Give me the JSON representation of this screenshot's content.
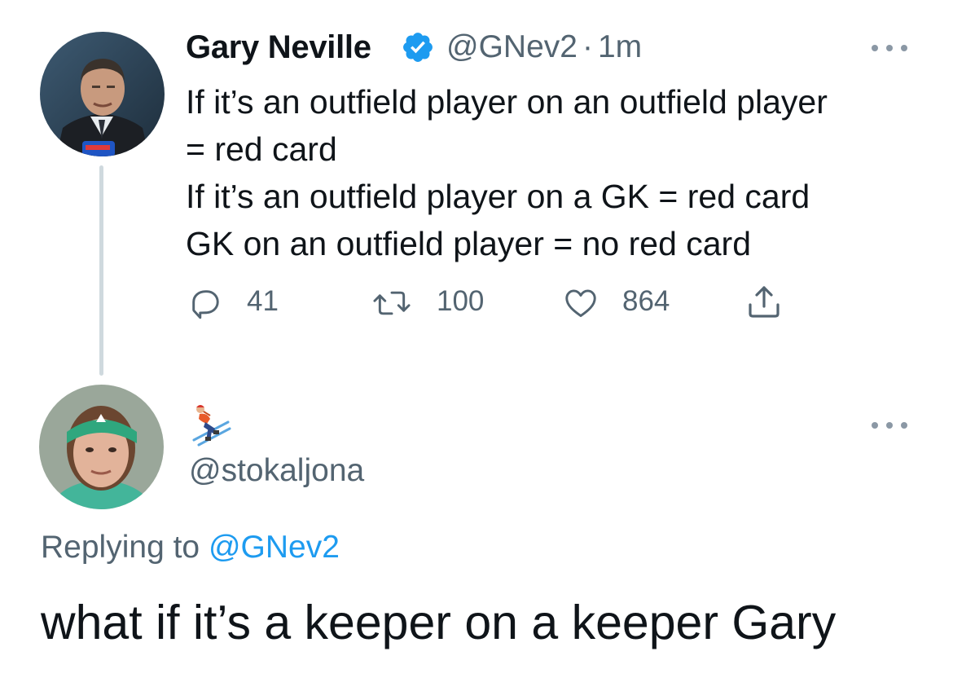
{
  "colors": {
    "accent": "#1d9bf0",
    "secondary_text": "#536471",
    "primary_text": "#0f1419",
    "thread_line": "#cfd9de"
  },
  "tweet": {
    "author_name": "Gary Neville",
    "verified_icon": "verified-badge-icon",
    "handle": "@GNev2",
    "separator": "·",
    "time": "1m",
    "lines": [
      "If it’s an outfield player on an outfield player",
      "= red card",
      "If it’s an outfield player on a GK = red card",
      "GK on an outfield player = no red card"
    ],
    "actions": {
      "replies": {
        "icon": "reply-icon",
        "count": "41"
      },
      "retweets": {
        "icon": "retweet-icon",
        "count": "100"
      },
      "likes": {
        "icon": "heart-icon",
        "count": "864"
      },
      "share": {
        "icon": "share-icon"
      }
    }
  },
  "reply": {
    "display_name_icon": "skier-emoji-icon",
    "handle": "@stokaljona",
    "replying_prefix": "Replying to",
    "replying_to": "@GNev2",
    "text": "what if it’s a keeper on a keeper Gary"
  }
}
